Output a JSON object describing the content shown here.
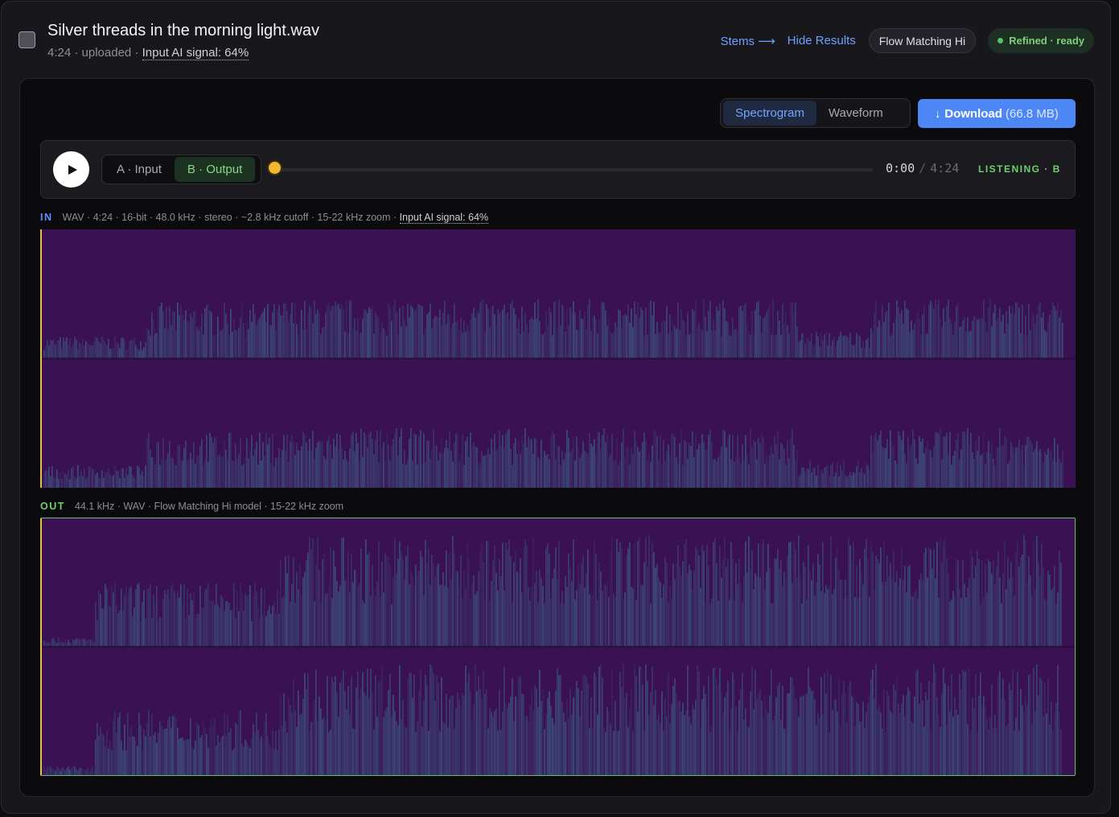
{
  "file": {
    "title": "Silver threads in the morning light.wav",
    "meta": "4:24 · uploaded · ",
    "ai_signal": "Input AI signal: 64%"
  },
  "header": {
    "stems_label": "Stems ⟶",
    "hide_results_label": "Hide Results",
    "model_label": "Flow Matching Hi",
    "status_label": "Refined · ready"
  },
  "view_toggle": {
    "spectrogram_label": "Spectrogram",
    "waveform_label": "Waveform",
    "active": "Spectrogram"
  },
  "download": {
    "label": "Download",
    "size": "(66.8 MB)"
  },
  "player": {
    "a_label": "A · Input",
    "b_label": "B · Output",
    "active_track": "B",
    "current_time": "0:00",
    "separator": "/",
    "duration": "4:24",
    "progress": 0,
    "listening_label": "LISTENING · B"
  },
  "lanes": {
    "input": {
      "tag": "IN",
      "meta": "WAV · 4:24 · 16-bit · 48.0 kHz · stereo · ~2.8 kHz cutoff · 15-22 kHz zoom · ",
      "ai_signal": "Input AI signal: 64%"
    },
    "output": {
      "tag": "OUT",
      "meta": "44.1 kHz · WAV · Flow Matching Hi model · 15-22 kHz zoom"
    }
  },
  "colors": {
    "accent_blue": "#4d86f5",
    "ready_green": "#6ed16c",
    "playhead_yellow": "#e2c23a",
    "spectrogram_bg": "#3a1253",
    "spectrogram_energy": "#3f8fa8"
  }
}
